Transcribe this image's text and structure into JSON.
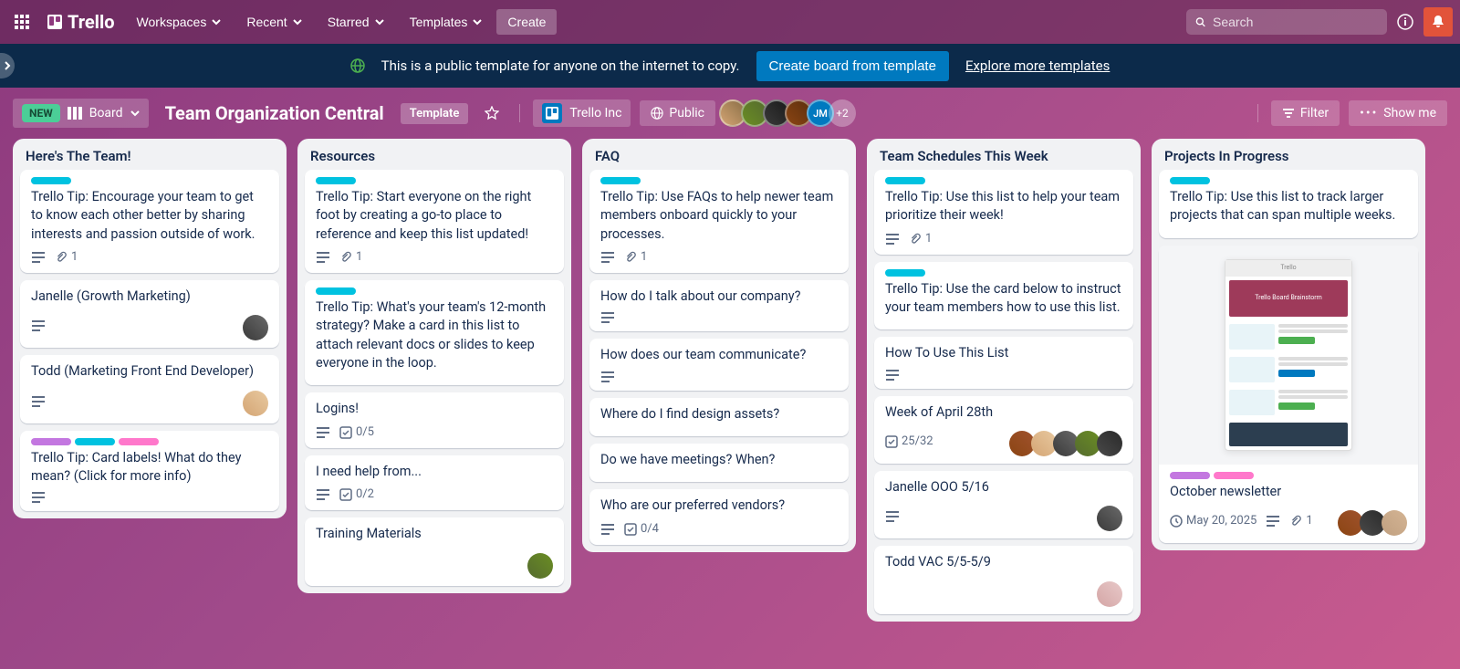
{
  "topnav": {
    "brand": "Trello",
    "menus": [
      "Workspaces",
      "Recent",
      "Starred",
      "Templates"
    ],
    "create": "Create",
    "search_placeholder": "Search"
  },
  "banner": {
    "text": "This is a public template for anyone on the internet to copy.",
    "create_btn": "Create board from template",
    "explore_link": "Explore more templates"
  },
  "board_header": {
    "new_badge": "NEW",
    "view": "Board",
    "title": "Team Organization Central",
    "template_badge": "Template",
    "workspace": "Trello Inc",
    "visibility": "Public",
    "member_initials": "JM",
    "more_count": "+2",
    "filter": "Filter",
    "show_menu": "Show me"
  },
  "lists": [
    {
      "title": "Here's The Team!",
      "cards": [
        {
          "labels": [
            "teal"
          ],
          "text": "Trello Tip: Encourage your team to get to know each other better by sharing interests and passion outside of work.",
          "badges": {
            "desc": true,
            "attach": "1"
          }
        },
        {
          "text": "Janelle (Growth Marketing)",
          "badges": {
            "desc": true
          },
          "members": [
            "p1"
          ]
        },
        {
          "text": "Todd (Marketing Front End Developer)",
          "badges": {
            "desc": true
          },
          "members": [
            "p2"
          ]
        },
        {
          "labels": [
            "purple",
            "teal",
            "pink"
          ],
          "text": "Trello Tip: Card labels! What do they mean? (Click for more info)",
          "badges": {
            "desc": true
          }
        }
      ]
    },
    {
      "title": "Resources",
      "cards": [
        {
          "labels": [
            "teal"
          ],
          "text": "Trello Tip: Start everyone on the right foot by creating a go-to place to reference and keep this list updated!",
          "badges": {
            "desc": true,
            "attach": "1"
          }
        },
        {
          "labels": [
            "teal"
          ],
          "text": "Trello Tip: What's your team's 12-month strategy? Make a card in this list to attach relevant docs or slides to keep everyone in the loop."
        },
        {
          "text": "Logins!",
          "badges": {
            "desc": true,
            "check": "0/5"
          }
        },
        {
          "text": "I need help from...",
          "badges": {
            "desc": true,
            "check": "0/2"
          }
        },
        {
          "text": "Training Materials",
          "members": [
            "p3"
          ]
        }
      ]
    },
    {
      "title": "FAQ",
      "cards": [
        {
          "labels": [
            "teal"
          ],
          "text": "Trello Tip: Use FAQs to help newer team members onboard quickly to your processes.",
          "badges": {
            "desc": true,
            "attach": "1"
          }
        },
        {
          "text": "How do I talk about our company?",
          "badges": {
            "desc": true
          }
        },
        {
          "text": "How does our team communicate?",
          "badges": {
            "desc": true
          }
        },
        {
          "text": "Where do I find design assets?"
        },
        {
          "text": "Do we have meetings? When?"
        },
        {
          "text": "Who are our preferred vendors?",
          "badges": {
            "desc": true,
            "check": "0/4"
          }
        }
      ]
    },
    {
      "title": "Team Schedules This Week",
      "cards": [
        {
          "labels": [
            "teal"
          ],
          "text": "Trello Tip: Use this list to help your team prioritize their week!",
          "badges": {
            "desc": true,
            "attach": "1"
          }
        },
        {
          "labels": [
            "teal"
          ],
          "text": "Trello Tip: Use the card below to instruct your team members how to use this list."
        },
        {
          "text": "How To Use This List",
          "badges": {
            "desc": true
          }
        },
        {
          "text": "Week of April 28th",
          "badges": {
            "check": "25/32"
          },
          "members": [
            "p4",
            "p2",
            "p1",
            "p3",
            "p5"
          ]
        },
        {
          "text": "Janelle OOO 5/16",
          "badges": {
            "desc": true
          },
          "members": [
            "p1"
          ]
        },
        {
          "text": "Todd VAC 5/5-5/9",
          "members": [
            "p6"
          ]
        }
      ]
    },
    {
      "title": "Projects In Progress",
      "cards": [
        {
          "labels": [
            "teal"
          ],
          "text": "Trello Tip: Use this list to track larger projects that can span multiple weeks."
        },
        {
          "cover": true,
          "labels": [
            "purple",
            "pink"
          ],
          "text": "October newsletter",
          "badges": {
            "date": "May 20, 2025",
            "desc": true,
            "attach": "1"
          },
          "members": [
            "p4",
            "p5",
            "p7"
          ]
        }
      ]
    }
  ],
  "cover_mock": {
    "header": "Trello",
    "hero": "Trello Board Brainstorm"
  }
}
